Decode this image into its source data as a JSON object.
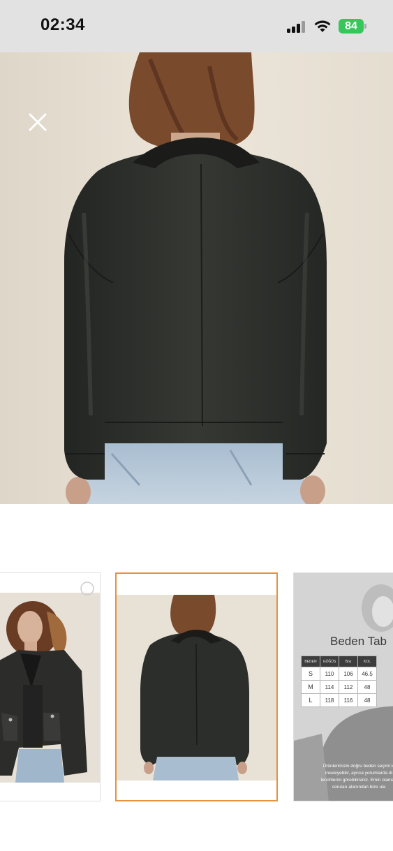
{
  "status_bar": {
    "time": "02:34",
    "battery_level": "84",
    "icons": [
      "cellular-signal-icon",
      "wifi-icon",
      "battery-icon"
    ]
  },
  "viewer": {
    "close_icon": "close-icon",
    "main_image": "back view of black leather jacket"
  },
  "thumbnails": [
    {
      "image": "model front view wearing black leather jacket",
      "selected": false
    },
    {
      "image": "back view of black leather jacket",
      "selected": true
    },
    {
      "image": "size chart",
      "selected": false
    }
  ],
  "size_chart": {
    "title": "Beden Tab",
    "headers": [
      "BEDEN",
      "GÖĞÜS",
      "Boy",
      "KOL"
    ],
    "rows": [
      {
        "size": "S",
        "gogus": "110",
        "boy": "106",
        "kol": "46.5"
      },
      {
        "size": "M",
        "gogus": "114",
        "boy": "112",
        "kol": "48"
      },
      {
        "size": "L",
        "gogus": "118",
        "boy": "116",
        "kol": "48"
      }
    ],
    "note_lines": [
      "Ürünlerimizin doğru beden seçimi iç",
      "inceleyebilir, ayrıca yorumlarda di",
      "tercihlerini görebilirsiniz. Emin olamad",
      "soruları alanından bize ula"
    ]
  },
  "colors": {
    "status_bar_bg": "#e2e2e2",
    "battery_green": "#35c759",
    "selected_border": "#e8923a"
  }
}
